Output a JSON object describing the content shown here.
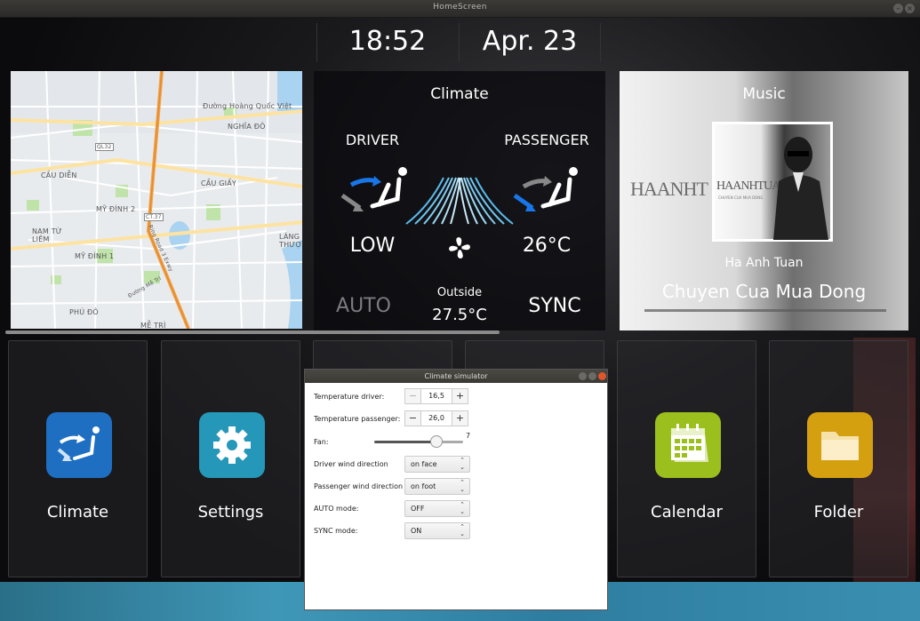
{
  "window": {
    "title": "HomeScreen"
  },
  "clock": {
    "time": "18:52",
    "date": "Apr. 23"
  },
  "map": {
    "labels": [
      "Đường Hoàng Quốc Việt",
      "NGHĨA ĐÔ",
      "CẦU DIỄN",
      "CẦU GIẤY",
      "MỸ ĐÌNH 2",
      "NAM TỪ LIÊM",
      "MỸ ĐÌNH 1",
      "LÁNG THƯỢNG",
      "PHÚ ĐÔ",
      "MỄ TRÌ",
      "Đường Mễ Trì",
      "Ring Road 3 Exwy",
      "QL32",
      "CT.37"
    ]
  },
  "climate": {
    "title": "Climate",
    "driver_label": "DRIVER",
    "passenger_label": "PASSENGER",
    "fan_level": "LOW",
    "passenger_temp": "26°C",
    "auto_label": "AUTO",
    "outside_label": "Outside",
    "outside_temp": "27.5°C",
    "sync_label": "SYNC"
  },
  "music": {
    "title": "Music",
    "artist": "Ha Anh Tuan",
    "song": "Chuyen Cua Mua Dong",
    "album_logo": "HAANHTUAN",
    "album_sub": "CHUYEN CUA MUA DONG",
    "progress": 0.0
  },
  "tiles": [
    {
      "label": "Climate",
      "color": "#1e6fc2",
      "icon": "climate-seat-icon"
    },
    {
      "label": "Settings",
      "color": "#2597b8",
      "icon": "gear-icon"
    },
    {
      "label": "Calendar",
      "color": "#9bbf1c",
      "icon": "calendar-icon"
    },
    {
      "label": "Folder",
      "color": "#d4a010",
      "icon": "folder-icon"
    }
  ],
  "dialog": {
    "title": "Climate simulator",
    "temp_driver_label": "Temperature driver:",
    "temp_driver_value": "16,5",
    "temp_passenger_label": "Temperature passenger:",
    "temp_passenger_value": "26,0",
    "fan_label": "Fan:",
    "fan_value": "7",
    "fan_fraction": 0.7,
    "driver_wind_label": "Driver wind direction",
    "driver_wind_value": "on face",
    "passenger_wind_label": "Passenger wind direction",
    "passenger_wind_value": "on foot",
    "auto_label": "AUTO mode:",
    "auto_value": "OFF",
    "sync_label": "SYNC mode:",
    "sync_value": "ON",
    "minus": "−",
    "plus": "+"
  }
}
